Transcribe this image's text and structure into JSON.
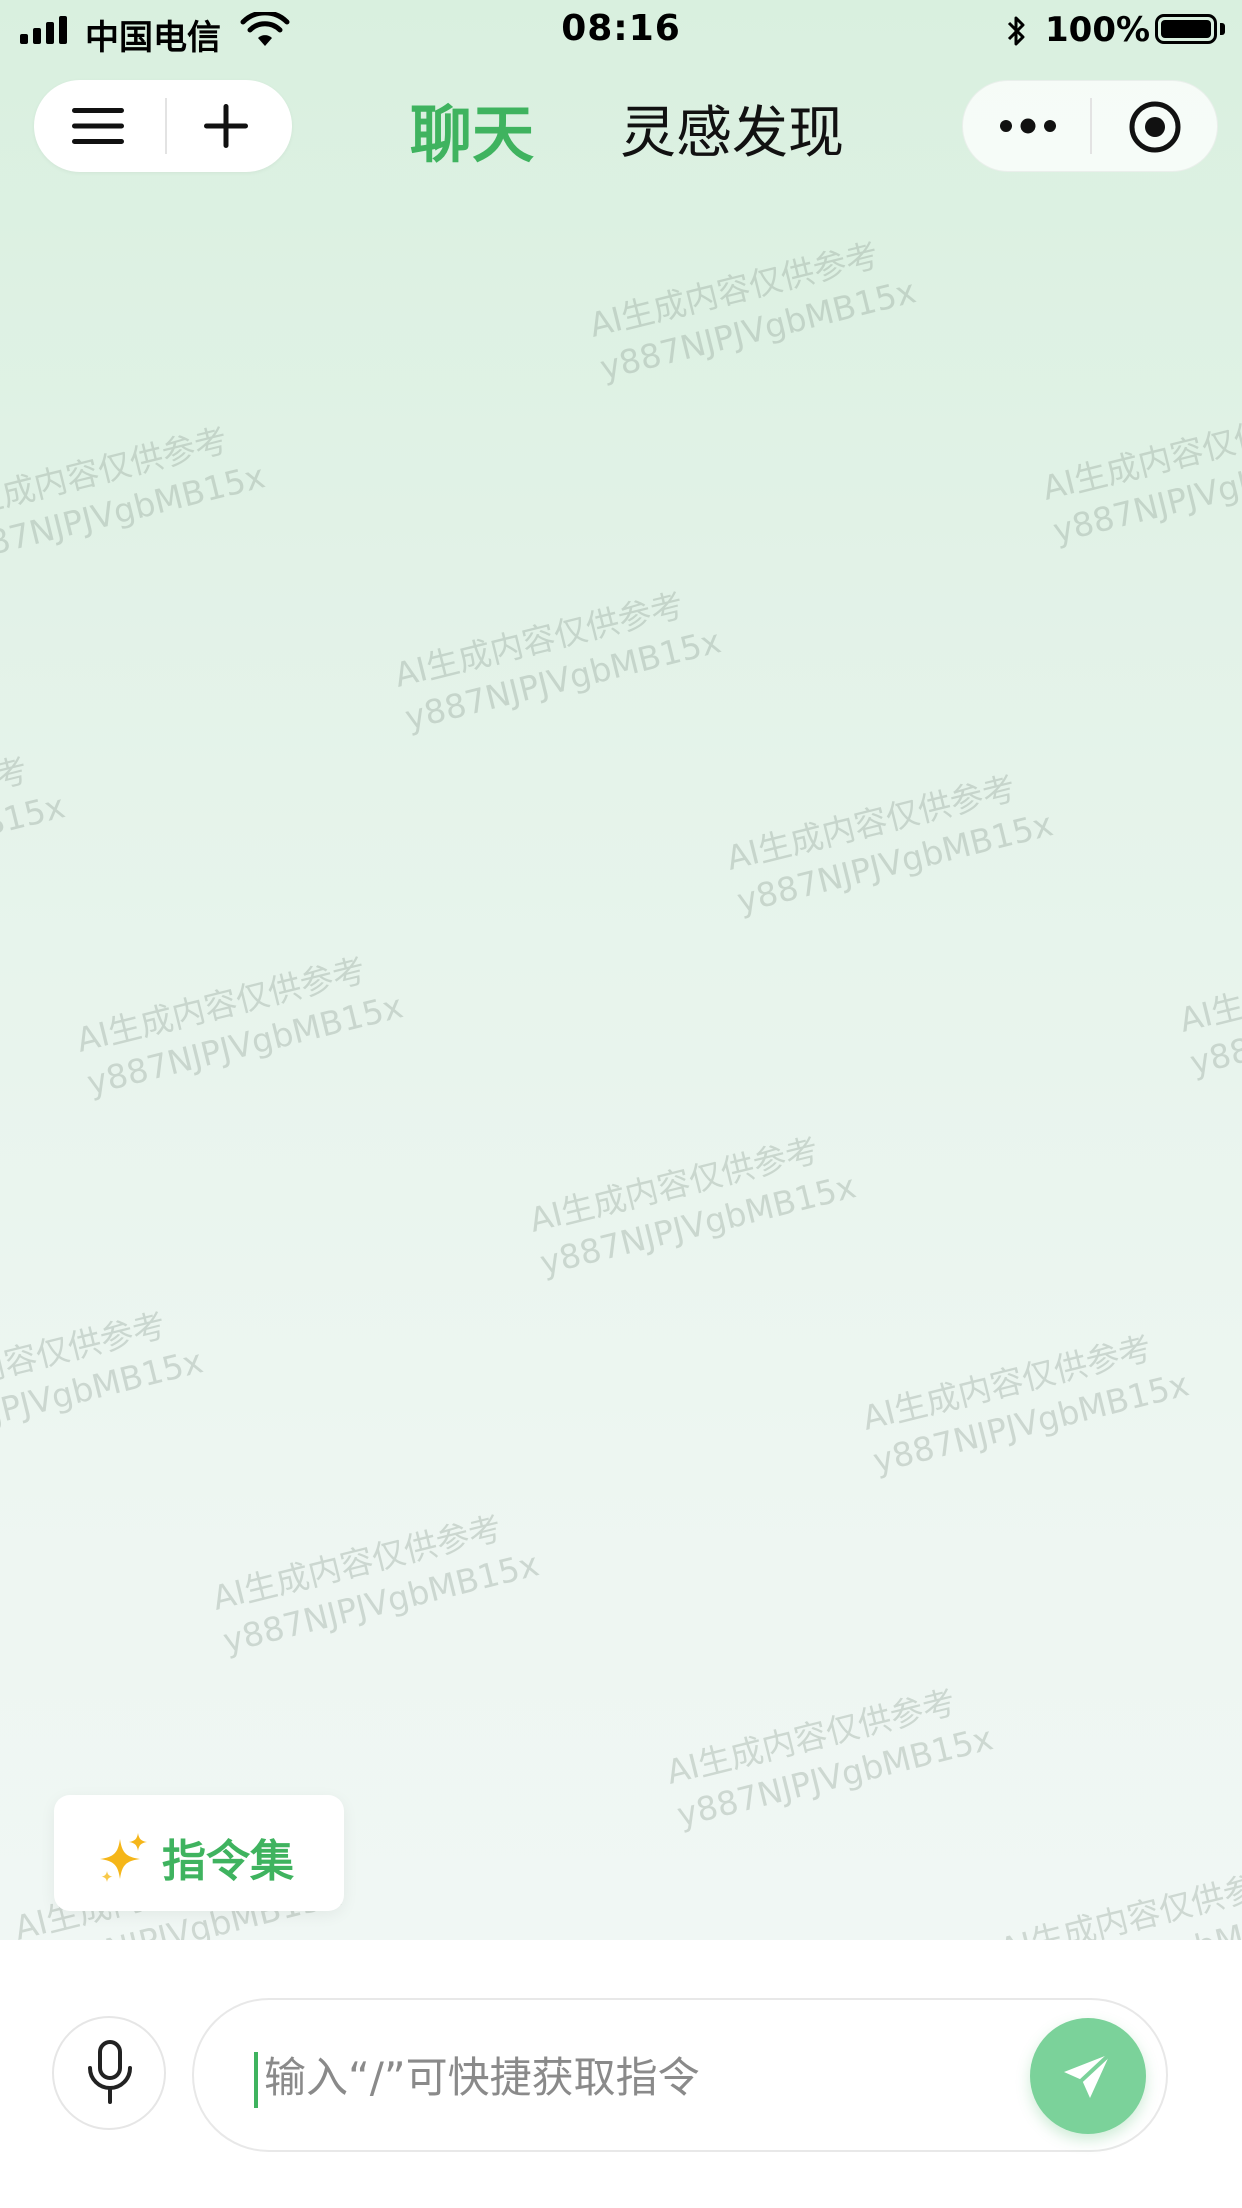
{
  "status_bar": {
    "carrier": "中国电信",
    "time": "08:16",
    "battery_percent": "100%"
  },
  "nav": {
    "tabs": [
      {
        "label": "聊天",
        "active": true
      },
      {
        "label": "灵感发现",
        "active": false
      }
    ],
    "left_icons": [
      "menu-icon",
      "plus-icon"
    ],
    "right_icons": [
      "more-icon",
      "target-icon"
    ]
  },
  "watermark": {
    "line1": "AI生成内容仅供参考",
    "line2": "y887NJPJVgbMB15x"
  },
  "commands_chip": {
    "label": "指令集",
    "icon": "sparkle-icon"
  },
  "input": {
    "placeholder": "输入“/”可快捷获取指令",
    "value": ""
  },
  "colors": {
    "accent": "#3fb35f",
    "send_button": "#7bd29a",
    "sparkle": "#f5b619"
  }
}
